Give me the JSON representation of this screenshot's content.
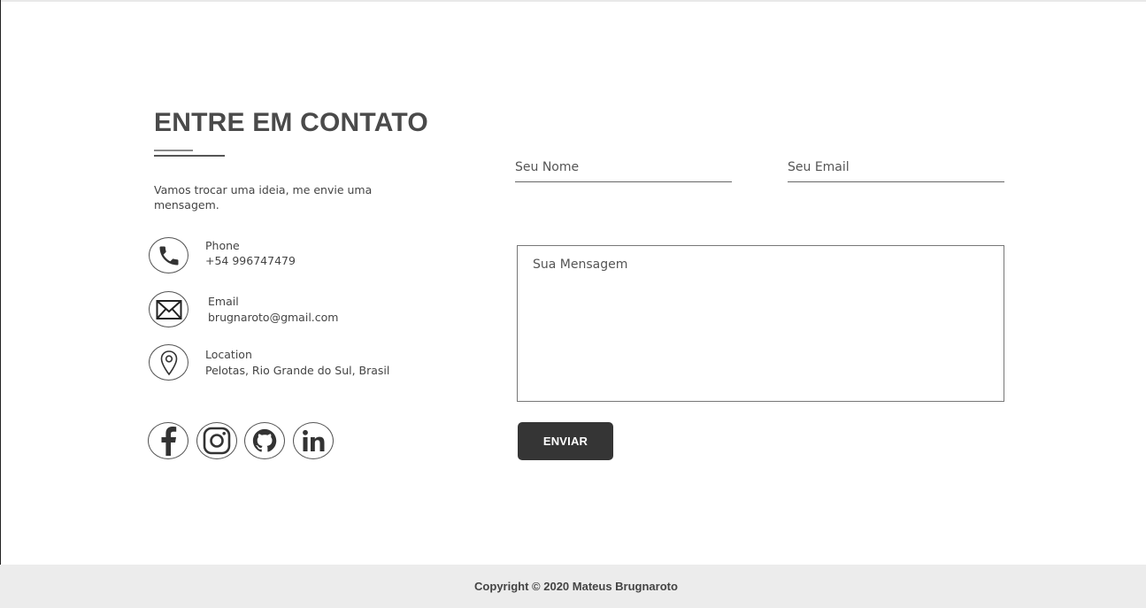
{
  "contact": {
    "title": "ENTRE EM CONTATO",
    "intro": "Vamos trocar uma ideia, me envie uma mensagem.",
    "items": [
      {
        "icon": "phone-icon",
        "label": "Phone",
        "value": "+54 996747479"
      },
      {
        "icon": "mail-icon",
        "label": "Email",
        "value": "brugnaroto@gmail.com"
      },
      {
        "icon": "location-pin-icon",
        "label": "Location",
        "value": "Pelotas, Rio Grande do Sul, Brasil"
      }
    ],
    "social": [
      "facebook-icon",
      "instagram-icon",
      "github-icon",
      "linkedin-icon"
    ]
  },
  "form": {
    "name_placeholder": "Seu Nome",
    "email_placeholder": "Seu Email",
    "message_placeholder": "Sua Mensagem",
    "submit_label": "ENVIAR"
  },
  "footer": {
    "copyright": "Copyright © 2020 Mateus Brugnaroto"
  },
  "colors": {
    "button": "#353535",
    "footer_bg": "#ececec",
    "text": "#444444"
  }
}
